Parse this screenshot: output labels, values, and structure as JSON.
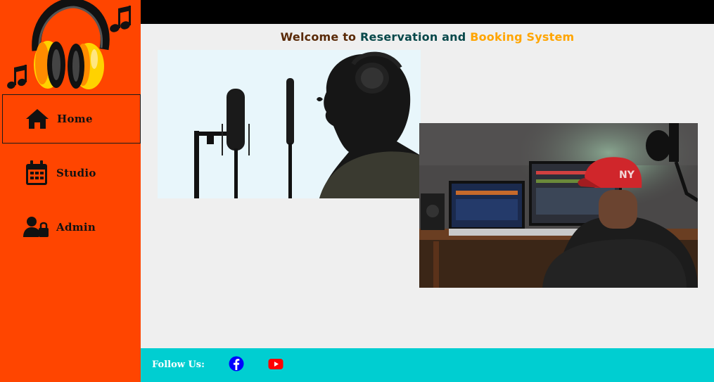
{
  "app": {
    "icon": "headphones-music-notes-logo"
  },
  "sidebar": {
    "items": [
      {
        "label": "Home",
        "icon": "home-icon",
        "active": true
      },
      {
        "label": "Studio",
        "icon": "calendar-icon",
        "active": false
      },
      {
        "label": "Admin",
        "icon": "user-lock-icon",
        "active": false
      }
    ]
  },
  "header": {
    "welcome_part1": "Welcome to ",
    "welcome_part2": "Reservation and ",
    "welcome_part3": "Booking System"
  },
  "main": {
    "images": [
      {
        "icon": "singer-microphone-photo"
      },
      {
        "icon": "music-studio-producer-photo"
      }
    ]
  },
  "footer": {
    "follow_label": "Follow Us:",
    "social": [
      {
        "icon": "facebook-icon"
      },
      {
        "icon": "youtube-icon"
      }
    ]
  },
  "colors": {
    "sidebar_bg": "#ff4500",
    "topbar_bg": "#000000",
    "main_bg": "#efefef",
    "footer_bg": "#00ced1",
    "welcome_brown": "#5a2a08",
    "welcome_teal": "#08484a",
    "welcome_orange": "#ffa500",
    "facebook_blue": "#0000ff",
    "youtube_red": "#ff0000"
  }
}
